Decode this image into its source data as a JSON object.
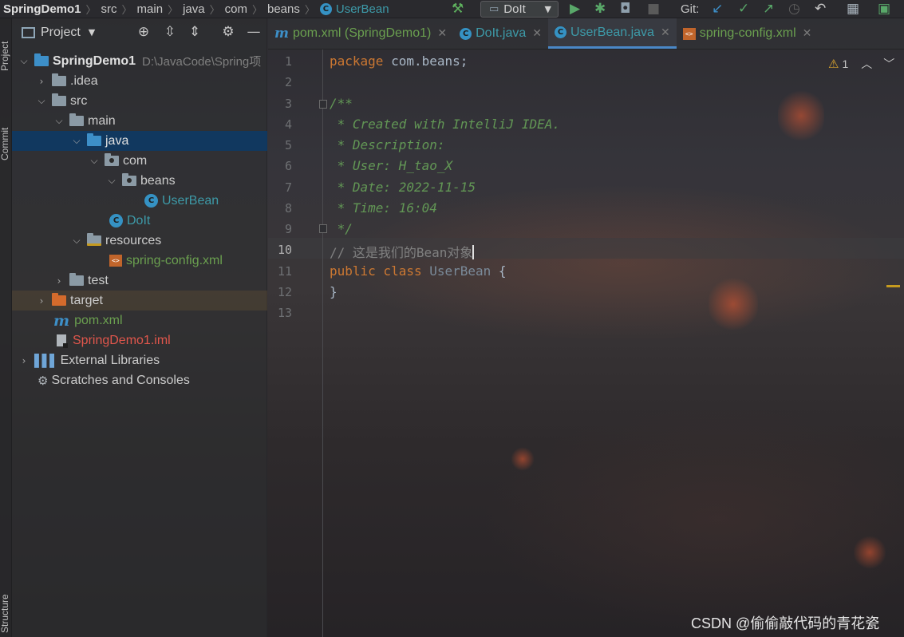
{
  "breadcrumb": {
    "items": [
      "SpringDemo1",
      "src",
      "main",
      "java",
      "com",
      "beans"
    ],
    "active": "UserBean"
  },
  "toolbar": {
    "run_config": "DoIt",
    "git_label": "Git:"
  },
  "left_strip": {
    "project": "Project",
    "commit": "Commit",
    "structure": "Structure"
  },
  "project_panel": {
    "title": "Project",
    "root": {
      "name": "SpringDemo1",
      "path": "D:\\JavaCode\\Spring项"
    },
    "nodes": [
      {
        "label": ".idea"
      },
      {
        "label": "src"
      },
      {
        "label": "main"
      },
      {
        "label": "java"
      },
      {
        "label": "com"
      },
      {
        "label": "beans"
      },
      {
        "label": "UserBean"
      },
      {
        "label": "DoIt"
      },
      {
        "label": "resources"
      },
      {
        "label": "spring-config.xml"
      },
      {
        "label": "test"
      },
      {
        "label": "target"
      },
      {
        "label": "pom.xml"
      },
      {
        "label": "SpringDemo1.iml"
      },
      {
        "label": "External Libraries"
      },
      {
        "label": "Scratches and Consoles"
      }
    ]
  },
  "tabs": [
    {
      "label": "pom.xml (SpringDemo1)"
    },
    {
      "label": "DoIt.java"
    },
    {
      "label": "UserBean.java"
    },
    {
      "label": "spring-config.xml"
    }
  ],
  "editor": {
    "line_numbers": [
      "1",
      "2",
      "3",
      "4",
      "5",
      "6",
      "7",
      "8",
      "9",
      "10",
      "11",
      "12",
      "13"
    ],
    "inspection_count": "1",
    "code": {
      "l1_kw": "package",
      "l1_rest": " com.beans;",
      "l3": "/**",
      "l4": " * Created with IntelliJ IDEA.",
      "l5": " * Description:",
      "l6": " * User: H_tao_X",
      "l7": " * Date: 2022-11-15",
      "l8": " * Time: 16:04",
      "l9": " */",
      "l10": "// 这是我们的Bean对象",
      "l11_kw": "public class",
      "l11_name": " UserBean",
      "l11_brace": " {",
      "l12": "}"
    }
  },
  "watermark": "CSDN @偷偷敲代码的青花瓷",
  "colors": {
    "accent": "#4a88c7",
    "keyword": "#cc7832",
    "doc_comment": "#629755",
    "selection": "#0e3a64"
  }
}
